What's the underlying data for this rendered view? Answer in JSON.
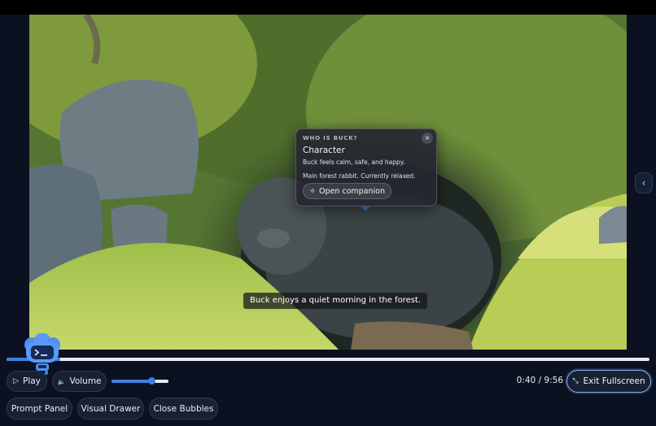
{
  "bubble": {
    "eyebrow": "WHO IS BUCK?",
    "title": "Character",
    "line1": "Buck feels calm, safe, and happy.",
    "line2": "Main forest rabbit. Currently relaxed.",
    "close_icon": "×",
    "companion_icon": "✧",
    "companion_label": "Open companion"
  },
  "subtitle": "Buck enjoys a quiet morning in the forest.",
  "side_toggle_icon": "‹",
  "playback": {
    "progress_fraction": 0.083,
    "time": "0:40 / 9:56",
    "volume_fraction": 0.7
  },
  "controls": {
    "play_icon": "▷",
    "play_label": "Play",
    "volume_icon": "🔈",
    "volume_label": "Volume",
    "exit_icon": "⤡",
    "exit_label": "Exit Fullscreen",
    "prompt_panel": "Prompt Panel",
    "visual_drawer": "Visual Drawer",
    "close_bubbles": "Close Bubbles"
  },
  "colors": {
    "accent": "#3f7fe0",
    "background": "#0b1120"
  }
}
